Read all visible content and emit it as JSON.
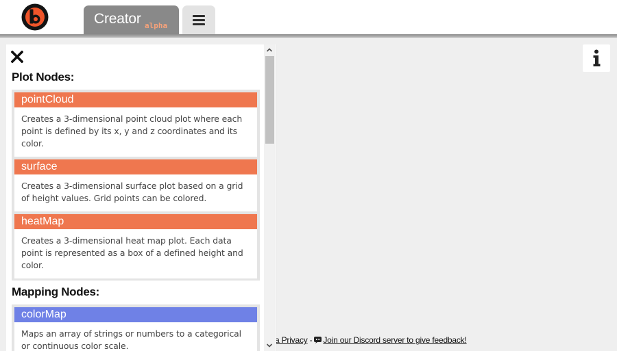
{
  "header": {
    "app_title": "Creator",
    "badge": "alpha"
  },
  "colors": {
    "plot_node_header": "#ef774f",
    "mapping_node_header": "#6f81e6",
    "creator_tab_bg": "#898989",
    "logo_accent": "#f0552a"
  },
  "icons": {
    "logo": "brand-logo",
    "menu": "hamburger-menu-icon",
    "close": "close-icon",
    "info": "info-icon",
    "discord": "discord-icon"
  },
  "panel": {
    "sections": [
      {
        "title": "Plot Nodes:",
        "nodes": [
          {
            "name": "pointCloud",
            "description": "Creates a 3-dimensional point cloud plot where each point is defined by its x, y and z coordinates and its color."
          },
          {
            "name": "surface",
            "description": "Creates a 3-dimensional surface plot based on a grid of height values. Grid points can be colored."
          },
          {
            "name": "heatMap",
            "description": "Creates a 3-dimensional heat map plot. Each data point is represented as a box of a defined height and color."
          }
        ]
      },
      {
        "title": "Mapping Nodes:",
        "nodes": [
          {
            "name": "colorMap",
            "description": "Maps an array of strings or numbers to a categorical or continuous color scale."
          }
        ]
      }
    ]
  },
  "footer": {
    "privacy_link": "a Privacy",
    "separator": "-",
    "discord_link": "Join our Discord server to give feedback!"
  }
}
